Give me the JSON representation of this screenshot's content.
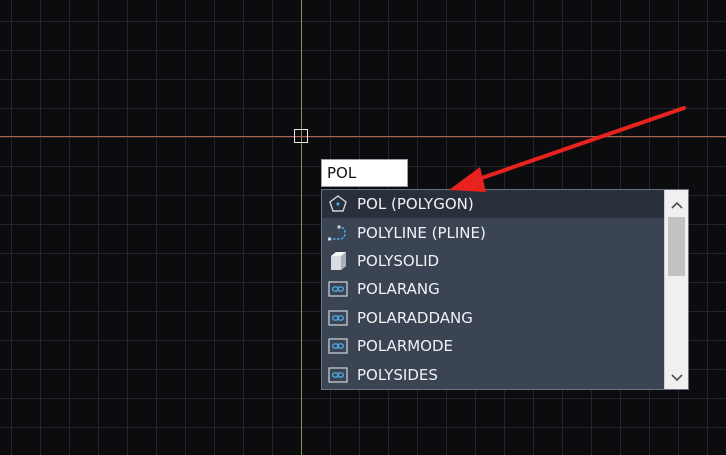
{
  "command_line": {
    "input_value": "POL"
  },
  "autocomplete": {
    "items": [
      {
        "label": "POL (POLYGON)",
        "icon": "polygon-icon",
        "selected": true
      },
      {
        "label": "POLYLINE (PLINE)",
        "icon": "polyline-icon",
        "selected": false
      },
      {
        "label": "POLYSOLID",
        "icon": "polysolid-icon",
        "selected": false
      },
      {
        "label": "POLARANG",
        "icon": "system-variable-icon",
        "selected": false
      },
      {
        "label": "POLARADDANG",
        "icon": "system-variable-icon",
        "selected": false
      },
      {
        "label": "POLARMODE",
        "icon": "system-variable-icon",
        "selected": false
      },
      {
        "label": "POLYSIDES",
        "icon": "system-variable-icon",
        "selected": false
      }
    ],
    "scroll_up_icon": "chevron-up-icon",
    "scroll_down_icon": "chevron-down-icon"
  },
  "colors": {
    "canvas_background": "#0c0c0f",
    "grid_line": "#23252c",
    "crosshair_vertical": "#7d9a56",
    "crosshair_horizontal": "#b5604f",
    "dropdown_background": "#3b4453",
    "selected_row": "#2a303b",
    "annotation_arrow": "#e8231f",
    "icon_accent": "#4aa8e0"
  }
}
